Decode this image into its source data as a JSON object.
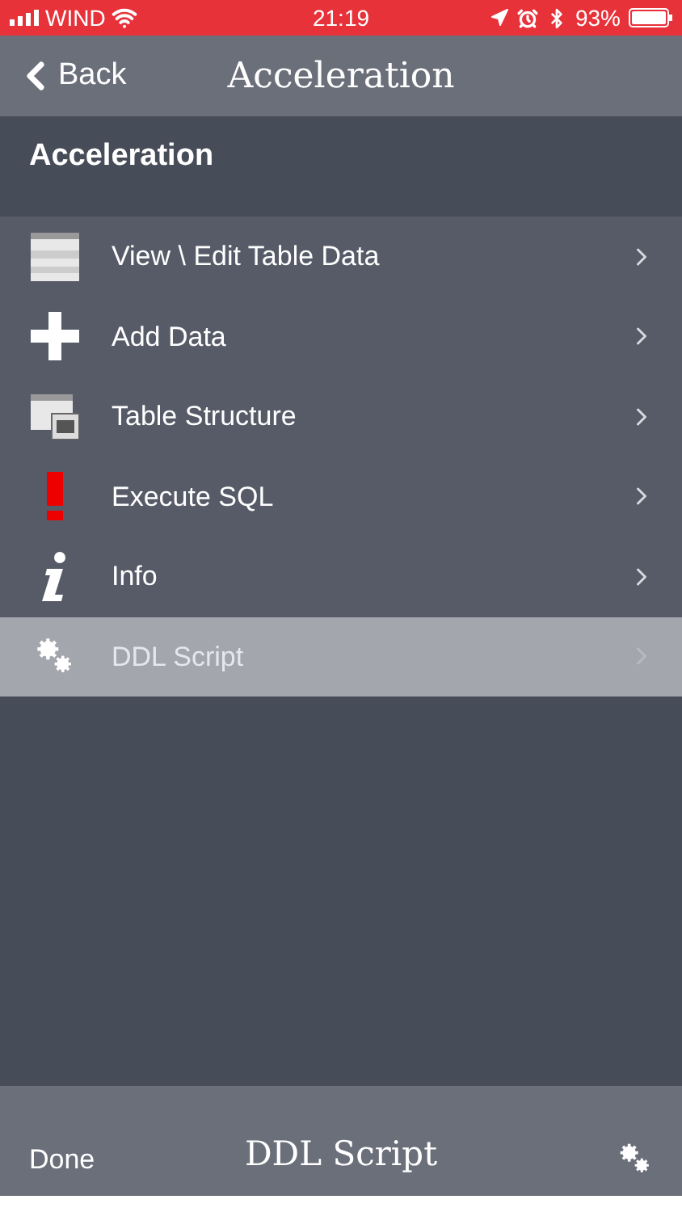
{
  "status_bar": {
    "carrier": "WIND",
    "time": "21:19",
    "battery": "93%"
  },
  "nav": {
    "back": "Back",
    "title": "Acceleration"
  },
  "section": {
    "title": "Acceleration"
  },
  "items": [
    {
      "kind": "table",
      "label": "View \\ Edit Table Data",
      "selected": false
    },
    {
      "kind": "plus",
      "label": "Add Data",
      "selected": false
    },
    {
      "kind": "structure",
      "label": "Table Structure",
      "selected": false
    },
    {
      "kind": "exclaim",
      "label": "Execute SQL",
      "selected": false
    },
    {
      "kind": "info",
      "label": "Info",
      "selected": false
    },
    {
      "kind": "gears",
      "label": "DDL Script",
      "selected": true
    }
  ],
  "sheet": {
    "done": "Done",
    "title": "DDL Script"
  }
}
